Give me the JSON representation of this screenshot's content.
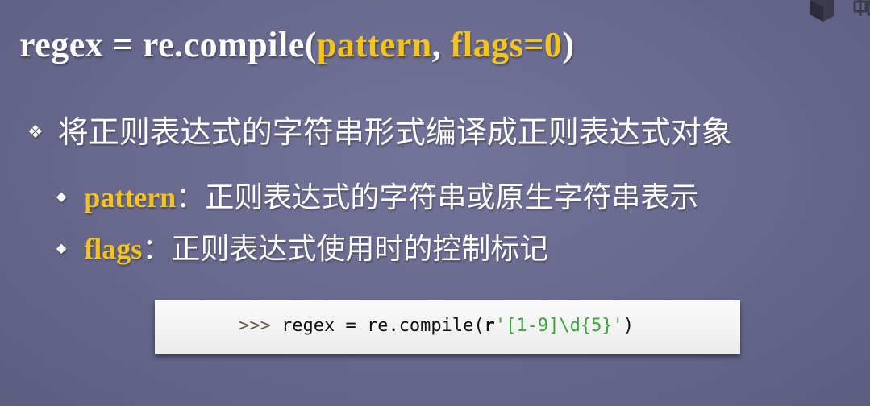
{
  "slide": {
    "title": {
      "prefix": "regex = re.compile(",
      "arg1": "pattern",
      "sep": ", ",
      "arg2": "flags=0",
      "suffix": ")"
    },
    "bullet": {
      "icon": "diamond-bullet-icon",
      "text": "将正则表达式的字符串形式编译成正则表达式对象"
    },
    "sub_bullets": [
      {
        "keyword": "pattern",
        "colon": "：",
        "text": "正则表达式的字符串或原生字符串表示"
      },
      {
        "keyword": "flags",
        "colon": "：",
        "text": "正则表达式使用时的控制标记"
      }
    ],
    "code": {
      "prompt": ">>>",
      "before": " regex = re.compile(",
      "raw": "r",
      "string": "'[1-9]\\d{5}'",
      "after": ")"
    },
    "watermark": "中国"
  },
  "colors": {
    "background": "#6b6b90",
    "highlight": "#f4c41a",
    "code_string": "#3aa53a"
  }
}
